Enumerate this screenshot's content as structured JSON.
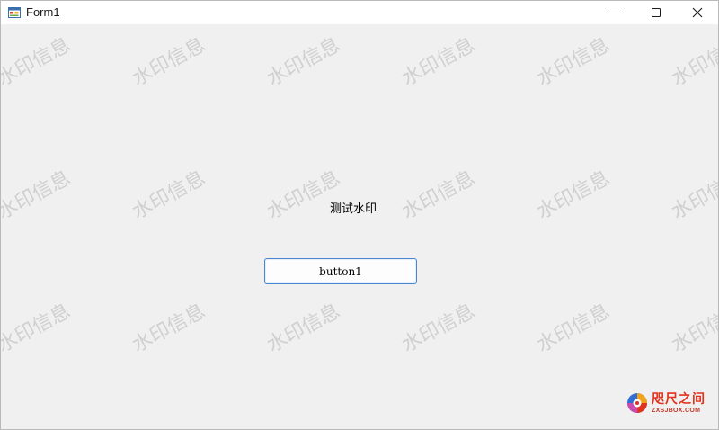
{
  "window": {
    "title": "Form1",
    "caption_buttons": {
      "minimize_icon": "minimize-icon",
      "maximize_icon": "maximize-icon",
      "close_icon": "close-icon"
    }
  },
  "form": {
    "label_text": "测试水印",
    "button_label": "button1"
  },
  "watermark": {
    "text": "水印信息",
    "color": "#d0d0d0"
  },
  "corner_logo": {
    "title": "咫尺之间",
    "domain": "ZXSJBOX.COM"
  },
  "colors": {
    "client_bg": "#f0f0f0",
    "titlebar_bg": "#ffffff",
    "button_border": "#4a86d0",
    "logo_red": "#e0321c"
  }
}
